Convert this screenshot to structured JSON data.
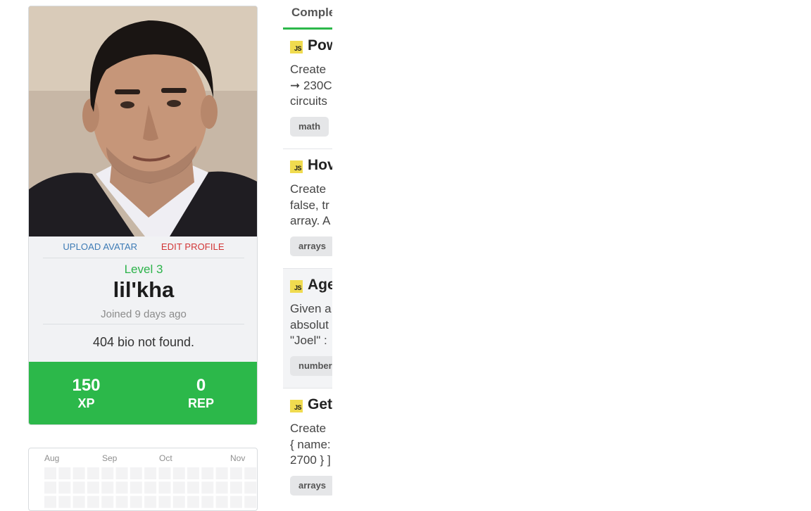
{
  "profile": {
    "upload_avatar": "UPLOAD AVATAR",
    "edit_profile": "EDIT PROFILE",
    "level": "Level 3",
    "username": "lil'kha",
    "joined": "Joined 9 days ago",
    "bio": "404 bio not found.",
    "stats": [
      {
        "value": "150",
        "label": "XP"
      },
      {
        "value": "0",
        "label": "REP"
      }
    ],
    "colors": {
      "accent": "#2cb84a",
      "upload": "#3d7bb5",
      "edit": "#d23535"
    }
  },
  "heatmap": {
    "months": [
      "Aug",
      "Sep",
      "Oct",
      "Nov"
    ]
  },
  "challenges": {
    "tab_label": "Comple",
    "items": [
      {
        "lang_badge": "JS",
        "title": "Pow",
        "lines": [
          "Create",
          "➞ 230C",
          "circuits"
        ],
        "tag": "math"
      },
      {
        "lang_badge": "JS",
        "title": "Hov",
        "lines": [
          "Create",
          "false, tr",
          "array. A"
        ],
        "tag": "arrays"
      },
      {
        "lang_badge": "JS",
        "title": "Age",
        "lines": [
          "Given a",
          "absolut",
          "\"Joel\" :"
        ],
        "tag": "number"
      },
      {
        "lang_badge": "JS",
        "title": "Get",
        "lines": [
          "Create",
          "{ name:",
          "2700 } ]"
        ],
        "tag": "arrays"
      }
    ]
  }
}
